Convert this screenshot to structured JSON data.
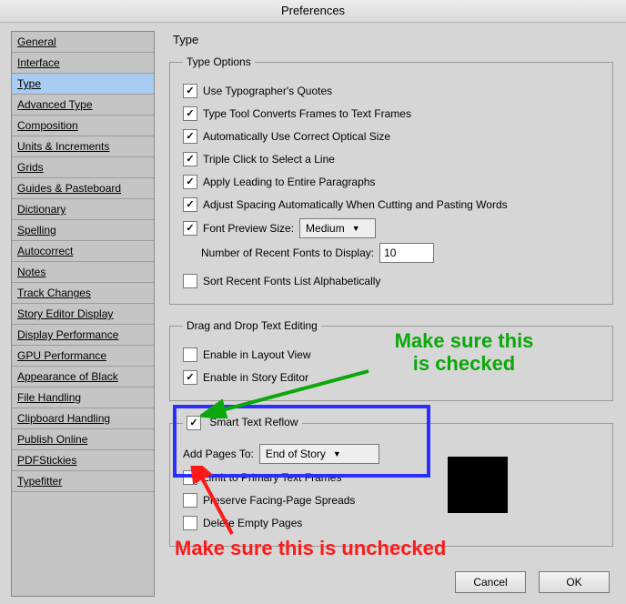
{
  "window": {
    "title": "Preferences"
  },
  "sidebar": {
    "selected_index": 2,
    "items": [
      {
        "label": "General"
      },
      {
        "label": "Interface"
      },
      {
        "label": "Type"
      },
      {
        "label": "Advanced Type"
      },
      {
        "label": "Composition"
      },
      {
        "label": "Units & Increments"
      },
      {
        "label": "Grids"
      },
      {
        "label": "Guides & Pasteboard"
      },
      {
        "label": "Dictionary"
      },
      {
        "label": "Spelling"
      },
      {
        "label": "Autocorrect"
      },
      {
        "label": "Notes"
      },
      {
        "label": "Track Changes"
      },
      {
        "label": "Story Editor Display"
      },
      {
        "label": "Display Performance"
      },
      {
        "label": "GPU Performance"
      },
      {
        "label": "Appearance of Black"
      },
      {
        "label": "File Handling"
      },
      {
        "label": "Clipboard Handling"
      },
      {
        "label": "Publish Online"
      },
      {
        "label": "PDFStickies"
      },
      {
        "label": "Typefitter"
      }
    ]
  },
  "panel": {
    "title": "Type",
    "type_options": {
      "legend": "Type Options",
      "typographers_quotes": {
        "label": "Use Typographer's Quotes",
        "checked": true
      },
      "converts_frames": {
        "label": "Type Tool Converts Frames to Text Frames",
        "checked": true
      },
      "auto_optical": {
        "label": "Automatically Use Correct Optical Size",
        "checked": true
      },
      "triple_click": {
        "label": "Triple Click to Select a Line",
        "checked": true
      },
      "apply_leading": {
        "label": "Apply Leading to Entire Paragraphs",
        "checked": true
      },
      "adjust_spacing": {
        "label": "Adjust Spacing Automatically When Cutting and Pasting Words",
        "checked": true
      },
      "font_preview": {
        "label": "Font Preview Size:",
        "checked": true,
        "value": "Medium"
      },
      "recent_fonts": {
        "label": "Number of Recent Fonts to Display:",
        "value": "10"
      },
      "sort_recent": {
        "label": "Sort Recent Fonts List Alphabetically",
        "checked": false
      }
    },
    "drag_drop": {
      "legend": "Drag and Drop Text Editing",
      "layout_view": {
        "label": "Enable in Layout View",
        "checked": false
      },
      "story_editor": {
        "label": "Enable in Story Editor",
        "checked": true
      }
    },
    "smart_reflow": {
      "legend": "Smart Text Reflow",
      "enabled": true,
      "add_pages": {
        "label": "Add Pages To:",
        "value": "End of Story"
      },
      "limit_primary": {
        "label": "Limit to Primary Text Frames",
        "checked": false
      },
      "preserve_facing": {
        "label": "Preserve Facing-Page Spreads",
        "checked": false
      },
      "delete_empty": {
        "label": "Delete Empty Pages",
        "checked": false
      }
    }
  },
  "buttons": {
    "cancel": "Cancel",
    "ok": "OK"
  },
  "annotations": {
    "green_text": "Make sure this\nis checked",
    "red_text": "Make sure this is unchecked"
  }
}
